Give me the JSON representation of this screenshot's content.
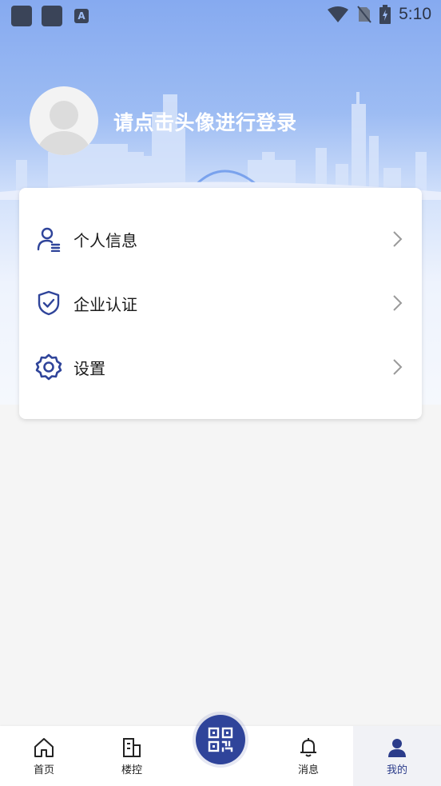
{
  "status_bar": {
    "time": "5:10",
    "app_icon_letter": "A"
  },
  "header": {
    "login_prompt": "请点击头像进行登录"
  },
  "menu": {
    "items": [
      {
        "label": "个人信息",
        "icon": "user-list-icon"
      },
      {
        "label": "企业认证",
        "icon": "shield-check-icon"
      },
      {
        "label": "设置",
        "icon": "gear-icon"
      }
    ]
  },
  "tabbar": {
    "tabs": [
      {
        "label": "首页",
        "icon": "home-icon"
      },
      {
        "label": "楼控",
        "icon": "building-icon"
      },
      {
        "label": "消息",
        "icon": "bell-icon"
      },
      {
        "label": "我的",
        "icon": "person-icon",
        "active": true
      }
    ],
    "center_button_icon": "qr-code-icon"
  },
  "colors": {
    "accent": "#2f449a",
    "hero_top": "#86aaf0",
    "background": "#f5f5f5"
  }
}
